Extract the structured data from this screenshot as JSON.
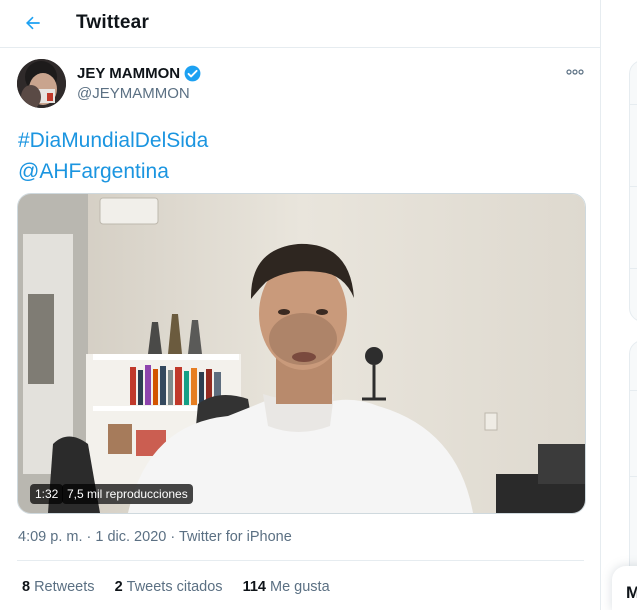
{
  "header": {
    "title": "Twittear",
    "back_icon": "arrow-left-icon"
  },
  "tweet": {
    "author": {
      "display_name": "JEY MAMMON",
      "handle": "@JEYMAMMON",
      "verified": true
    },
    "text_lines": [
      "#DiaMundialDelSida",
      "@AHFargentina"
    ],
    "media": {
      "duration": "1:32",
      "views": "7,5 mil reproducciones"
    },
    "timestamp": {
      "time": "4:09 p. m.",
      "date": "1 dic. 2020",
      "source": "Twitter for iPhone"
    },
    "stats": {
      "retweets_count": "8",
      "retweets_label": "Retweets",
      "quotes_count": "2",
      "quotes_label": "Tweets citados",
      "likes_count": "114",
      "likes_label": "Me gusta"
    }
  },
  "sidebar": {
    "message_drawer_initial": "M"
  },
  "colors": {
    "link": "#1b95e0",
    "text": "#0f1419",
    "secondary": "#5b7083",
    "verified": "#1da1f2",
    "border": "#e6ecf0"
  }
}
